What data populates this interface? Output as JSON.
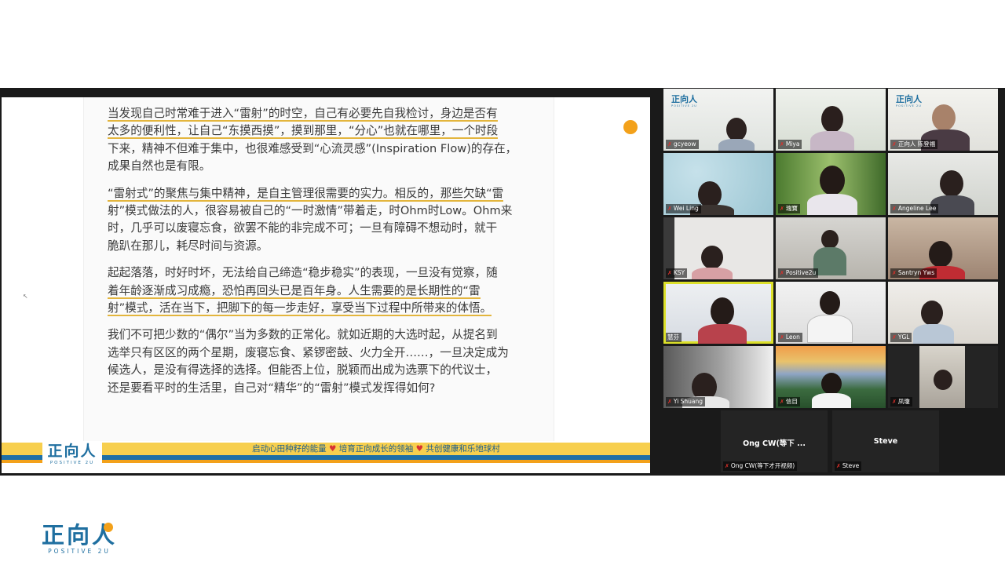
{
  "slide": {
    "paragraphs": [
      [
        "当发现自己时常难于进入“雷射”的时空，自己有必要先自我检讨，身边是否有",
        "太多的便利性，让自己“东摸西摸”，摸到那里，“分心”也就在哪里，一个时段",
        "下来，精神不但难于集中，也很难感受到“心流灵感”(Inspiration Flow)的存在，",
        "成果自然也是有限。"
      ],
      [
        "“雷射式”的聚焦与集中精神，是自主管理很需要的实力。相反的，那些欠缺“雷",
        "射”模式做法的人，很容易被自己的“一时激情”带着走，时Ohm时Low。Ohm来",
        "时，几乎可以废寝忘食，欲罢不能的非完成不可；一旦有障碍不想动时，就干",
        "脆趴在那儿，耗尽时间与资源。"
      ],
      [
        "起起落落，时好时坏，无法给自己缔造“稳步稳实”的表现，一旦没有觉察，随",
        "着年龄逐渐成习成瘾，恐怕再回头已是百年身。人生需要的是长期性的“雷",
        "射”模式，活在当下，把脚下的每一步走好，享受当下过程中所带来的体悟。"
      ],
      [
        "我们不可把少数的“偶尔”当为多数的正常化。就如近期的大选时起，从提名到",
        "选举只有区区的两个星期，废寝忘食、紧锣密鼓、火力全开……，一旦决定成为",
        "候选人，是没有得选择的选择。但能否上位，脱颖而出成为选票下的代议士，",
        "还是要看平时的生活里，自己对“精华”的“雷射”模式发挥得如何?"
      ]
    ],
    "banner_logo_cn": "正向人",
    "banner_logo_en": "POSITIVE 2U",
    "tagline": [
      "启动心田种籽的能量",
      "培育正向成长的领袖",
      "共创健康和乐地球村"
    ],
    "heart": "♥"
  },
  "participants": [
    {
      "name": "gcyeow"
    },
    {
      "name": "Miya"
    },
    {
      "name": "正向人 陈登福"
    },
    {
      "name": "Wei Ling"
    },
    {
      "name": "瑞寶"
    },
    {
      "name": "Angeline Lee"
    },
    {
      "name": "KSY"
    },
    {
      "name": "Positive2u"
    },
    {
      "name": "Santryn Yws"
    },
    {
      "name": "慧芬"
    },
    {
      "name": "Leon"
    },
    {
      "name": "YGL"
    },
    {
      "name": "Yi Shuang"
    },
    {
      "name": "信目"
    },
    {
      "name": "凤瓊"
    }
  ],
  "video_off": [
    {
      "big": "Ong CW(等下 ...",
      "label": "Ong CW(等下才开视频)"
    },
    {
      "big": "Steve",
      "label": "Steve"
    }
  ],
  "tile_logo": {
    "cn": "正向人",
    "en": "POSITIVE 2U"
  },
  "footer_logo": {
    "cn": "正向人",
    "en": "POSITIVE 2U"
  },
  "icons": {
    "muted": "mic-muted-icon",
    "cursor": "mouse-cursor-icon"
  },
  "colors": {
    "accent_yellow": "#f7cf4e",
    "brand_blue": "#1e6fa6",
    "brand_orange": "#f3a11a",
    "active_speaker": "#dce02a"
  }
}
